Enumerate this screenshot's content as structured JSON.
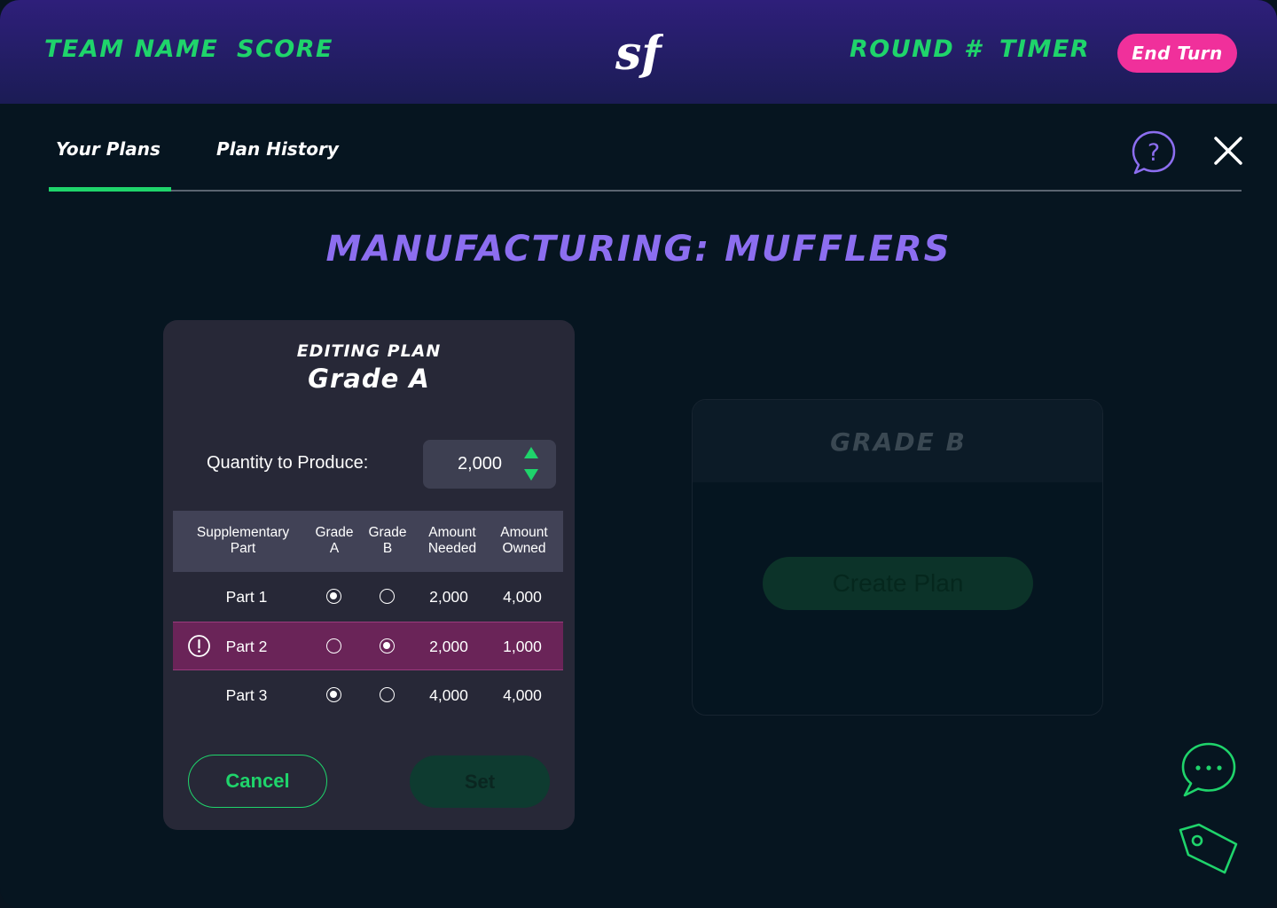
{
  "header": {
    "team_name": "TEAM NAME",
    "score": "SCORE",
    "logo_text": "sf",
    "round": "ROUND #",
    "timer": "TIMER",
    "end_turn_label": "End Turn"
  },
  "tabs": [
    {
      "label": "Your Plans",
      "active": true
    },
    {
      "label": "Plan History",
      "active": false
    }
  ],
  "icons": {
    "help": "help-icon",
    "close": "close-icon",
    "chat": "chat-icon",
    "tag": "price-tag-icon",
    "warning": "warning-icon"
  },
  "page_title": "MANUFACTURING: MUFFLERS",
  "editing_plan": {
    "eyebrow": "EDITING PLAN",
    "grade": "Grade A",
    "quantity_label": "Quantity to Produce:",
    "quantity_value": "2,000",
    "table": {
      "headers": {
        "part": [
          "Supplementary",
          "Part"
        ],
        "grade_a": [
          "Grade",
          "A"
        ],
        "grade_b": [
          "Grade",
          "B"
        ],
        "needed": [
          "Amount",
          "Needed"
        ],
        "owned": [
          "Amount",
          "Owned"
        ]
      },
      "rows": [
        {
          "part": "Part 1",
          "selected_grade": "A",
          "needed": "2,000",
          "owned": "4,000",
          "warning": false
        },
        {
          "part": "Part 2",
          "selected_grade": "B",
          "needed": "2,000",
          "owned": "1,000",
          "warning": true
        },
        {
          "part": "Part 3",
          "selected_grade": "A",
          "needed": "4,000",
          "owned": "4,000",
          "warning": false
        }
      ]
    },
    "cancel_label": "Cancel",
    "set_label": "Set"
  },
  "grade_b_card": {
    "title": "GRADE B",
    "create_label": "Create Plan"
  },
  "colors": {
    "accent_green": "#1fd46b",
    "accent_pink": "#f0309b",
    "title_purple": "#8c6ef0",
    "warning_row": "#6a2458"
  }
}
